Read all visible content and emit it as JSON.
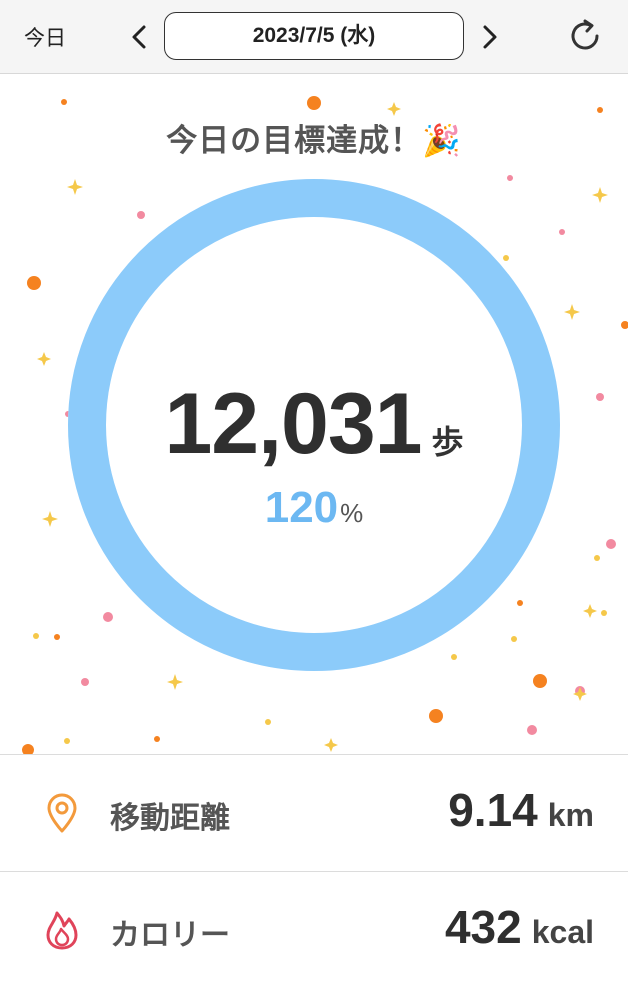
{
  "header": {
    "today_label": "今日",
    "date": "2023/7/5 (水)",
    "prev_icon": "chevron-left-icon",
    "next_icon": "chevron-right-icon",
    "refresh_icon": "refresh-icon"
  },
  "goal": {
    "title": "今日の目標達成！🎉",
    "steps": "12,031",
    "steps_unit": "歩",
    "percent": "120",
    "percent_sign": "%",
    "progress_fraction": 1.2,
    "ring_color": "#8ccbfa",
    "percent_color": "#6cb8f2"
  },
  "stats": [
    {
      "label": "移動距離",
      "value": "9.14",
      "unit": "km",
      "icon": "location-pin-icon",
      "icon_color": "#f39a3c"
    },
    {
      "label": "カロリー",
      "value": "432",
      "unit": "kcal",
      "icon": "flame-icon",
      "icon_color": "#e0445a"
    }
  ]
}
